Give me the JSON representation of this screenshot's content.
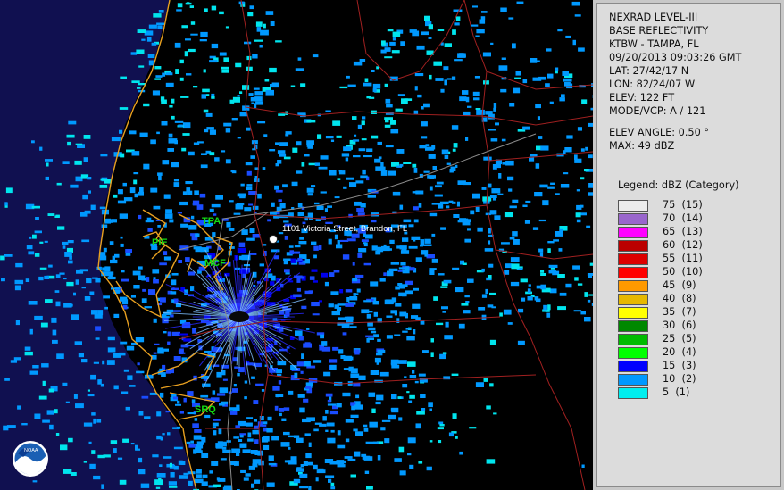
{
  "map": {
    "address_label": "1101 Victoria Street, Brandon, FL",
    "airports": [
      "TPA",
      "PIE",
      "MCF",
      "SRQ"
    ],
    "logo_text": "NOAA"
  },
  "info": {
    "product": "NEXRAD LEVEL-III",
    "type": "BASE REFLECTIVITY",
    "station": "KTBW - TAMPA, FL",
    "datetime": "09/20/2013 09:03:26 GMT",
    "lat": "LAT: 27/42/17 N",
    "lon": "LON: 82/24/07 W",
    "elev": "ELEV: 122 FT",
    "mode": "MODE/VCP: A / 121",
    "elev_angle": "ELEV ANGLE: 0.50 °",
    "max": "MAX: 49 dBZ"
  },
  "legend": {
    "title": "Legend: dBZ (Category)",
    "items": [
      {
        "label": "75  (15)",
        "color": "#ececec"
      },
      {
        "label": "70  (14)",
        "color": "#9966cc"
      },
      {
        "label": "65  (13)",
        "color": "#ff00ff"
      },
      {
        "label": "60  (12)",
        "color": "#bb0000"
      },
      {
        "label": "55  (11)",
        "color": "#dd0000"
      },
      {
        "label": "50  (10)",
        "color": "#ff0000"
      },
      {
        "label": "45  (9)",
        "color": "#ff9900"
      },
      {
        "label": "40  (8)",
        "color": "#e6b800"
      },
      {
        "label": "35  (7)",
        "color": "#ffff00"
      },
      {
        "label": "30  (6)",
        "color": "#008800"
      },
      {
        "label": "25  (5)",
        "color": "#00bb00"
      },
      {
        "label": "20  (4)",
        "color": "#00ff00"
      },
      {
        "label": "15  (3)",
        "color": "#0000ff"
      },
      {
        "label": "10  (2)",
        "color": "#0099ff"
      },
      {
        "label": "5  (1)",
        "color": "#00eeee"
      }
    ]
  }
}
